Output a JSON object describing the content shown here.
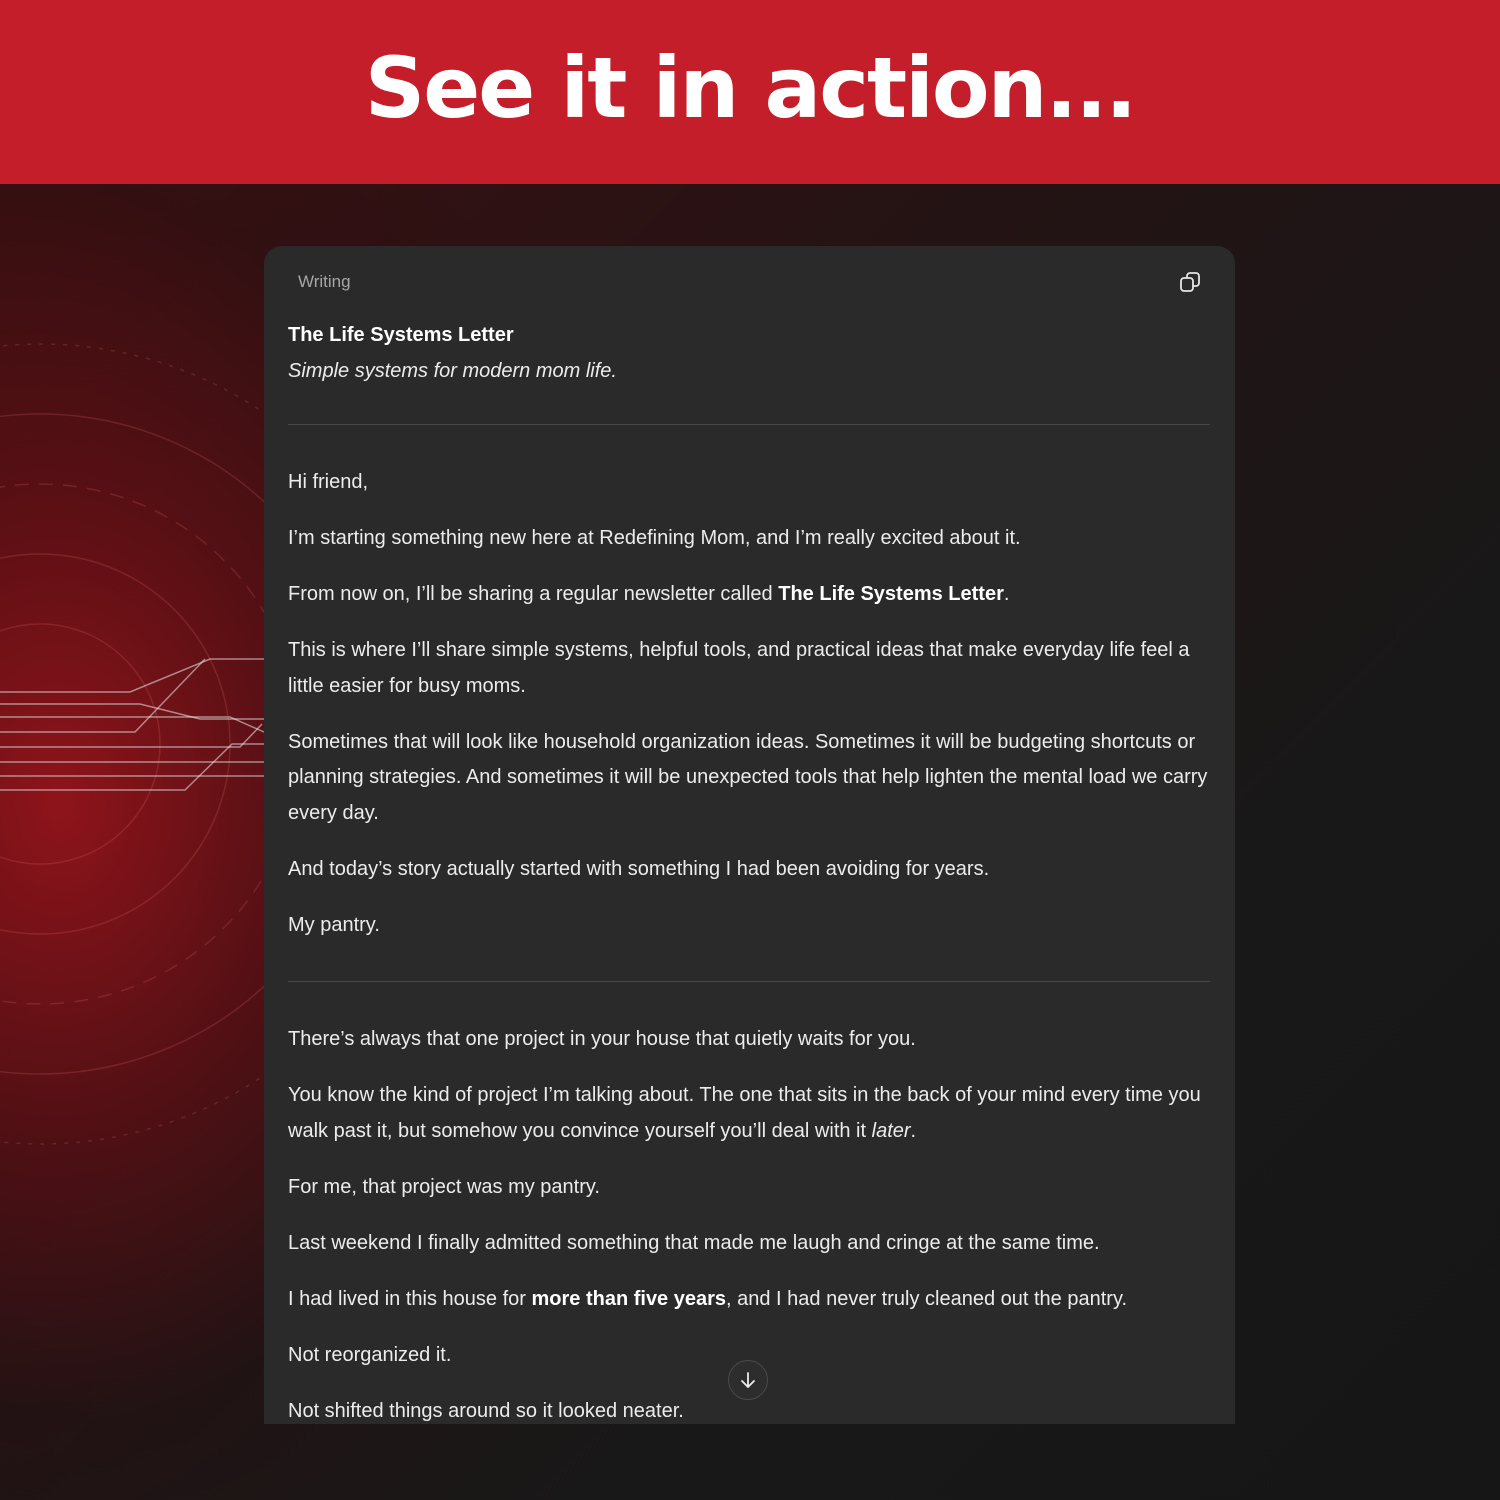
{
  "banner": {
    "title": "See it in action..."
  },
  "card": {
    "label": "Writing",
    "copy_icon": "copy-icon",
    "scroll_icon": "arrow-down-icon"
  },
  "document": {
    "title": "The Life Systems Letter",
    "tagline": "Simple systems for modern mom life.",
    "p1": "Hi friend,",
    "p2": "I’m starting something new here at Redefining Mom, and I’m really excited about it.",
    "p3_before": "From now on, I’ll be sharing a regular newsletter called ",
    "p3_bold": "The Life Systems Letter",
    "p3_after": ".",
    "p4": "This is where I’ll share simple systems, helpful tools, and practical ideas that make everyday life feel a little easier for busy moms.",
    "p5": "Sometimes that will look like household organization ideas. Sometimes it will be budgeting shortcuts or planning strategies. And sometimes it will be unexpected tools that help lighten the mental load we carry every day.",
    "p6": "And today’s story actually started with something I had been avoiding for years.",
    "p7": "My pantry.",
    "p8": "There’s always that one project in your house that quietly waits for you.",
    "p9_before": "You know the kind of project I’m talking about. The one that sits in the back of your mind every time you walk past it, but somehow you convince yourself you’ll deal with it ",
    "p9_italic": "later",
    "p9_after": ".",
    "p10": "For me, that project was my pantry.",
    "p11": "Last weekend I finally admitted something that made me laugh and cringe at the same time.",
    "p12_before": "I had lived in this house for ",
    "p12_bold": "more than five years",
    "p12_after": ", and I had never truly cleaned out the pantry.",
    "p13": "Not reorganized it.",
    "p14": "Not shifted things around so it looked neater."
  }
}
